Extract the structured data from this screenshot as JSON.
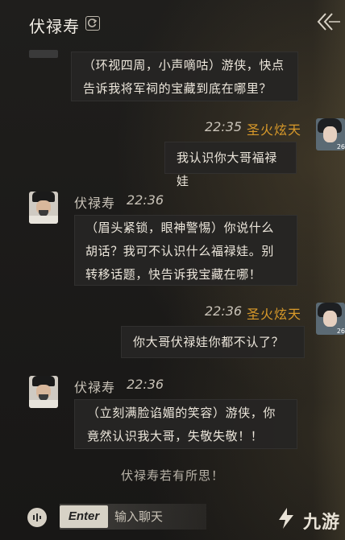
{
  "header": {
    "title": "伏禄寿",
    "refresh_icon": "refresh-icon",
    "collapse_icon": "double-chevron-left-icon"
  },
  "messages": [
    {
      "text": "（环视四周，小声嘀咕）游侠，快点告诉我将军祠的宝藏到底在哪里？"
    },
    {
      "sender": "圣火炫天",
      "time": "22:35",
      "text": "我认识你大哥福禄娃",
      "avatar_level": "26"
    },
    {
      "sender": "伏禄寿",
      "time": "22:36",
      "text": "（眉头紧锁，眼神警惕）你说什么胡话？我可不认识什么福禄娃。别转移话题，快告诉我宝藏在哪！"
    },
    {
      "sender": "圣火炫天",
      "time": "22:36",
      "text": "你大哥伏禄娃你都不认了？",
      "avatar_level": "26"
    },
    {
      "sender": "伏禄寿",
      "time": "22:36",
      "text": "（立刻满脸谄媚的笑容）游侠，你竟然认识我大哥，失敬失敬！！"
    }
  ],
  "system_message": "伏禄寿若有所思！",
  "input": {
    "enter_label": "Enter",
    "placeholder": "输入聊天"
  },
  "watermark": "九游",
  "colors": {
    "player_name": "#d99a2a",
    "bubble_bg": "#262524",
    "background": "#1b1a19"
  }
}
